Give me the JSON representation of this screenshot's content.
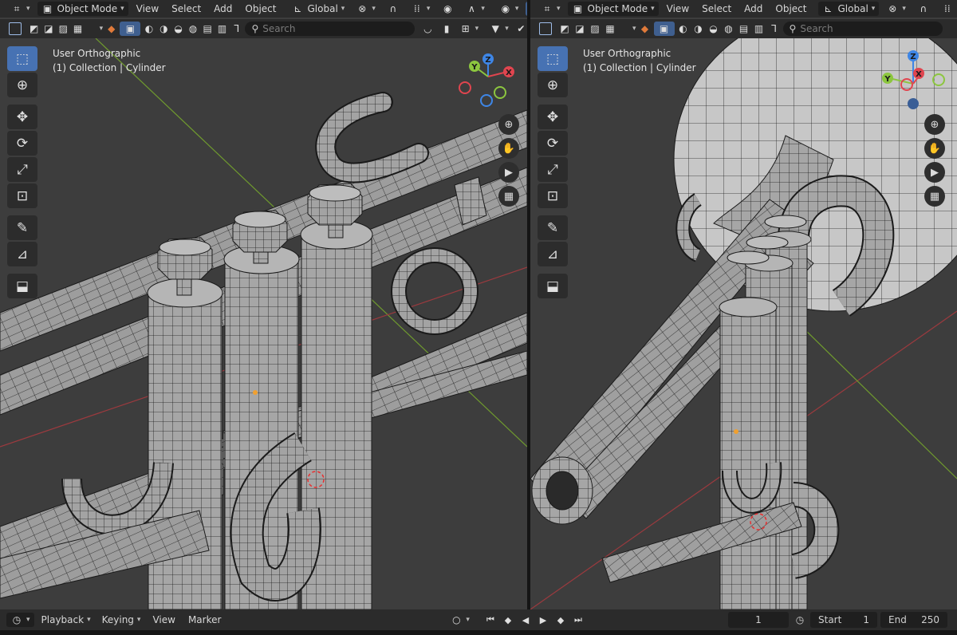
{
  "viewports": [
    {
      "header": {
        "mode": "Object Mode",
        "menus": [
          "View",
          "Select",
          "Add",
          "Object"
        ],
        "orientation": "Global"
      },
      "search_placeholder": "Search",
      "view_info": {
        "projection": "User Orthographic",
        "collection": "(1) Collection | Cylinder"
      },
      "gizmo_axes": [
        "X",
        "Y",
        "Z"
      ]
    },
    {
      "header": {
        "mode": "Object Mode",
        "menus": [
          "View",
          "Select",
          "Add",
          "Object"
        ],
        "orientation": "Global"
      },
      "search_placeholder": "Search",
      "view_info": {
        "projection": "User Orthographic",
        "collection": "(1) Collection | Cylinder"
      },
      "gizmo_axes": [
        "X",
        "Y",
        "Z"
      ]
    }
  ],
  "timeline": {
    "menus": [
      "Playback",
      "Keying",
      "View",
      "Marker"
    ],
    "current_frame": "1",
    "start_label": "Start",
    "start_value": "1",
    "end_label": "End",
    "end_value": "250"
  },
  "colors": {
    "accent": "#4772b3",
    "axis_x": "#e0454f",
    "axis_y": "#8cc63f",
    "axis_z": "#3e86e6",
    "viewport_bg": "#3d3d3d",
    "header_bg": "#2b2b2b"
  }
}
